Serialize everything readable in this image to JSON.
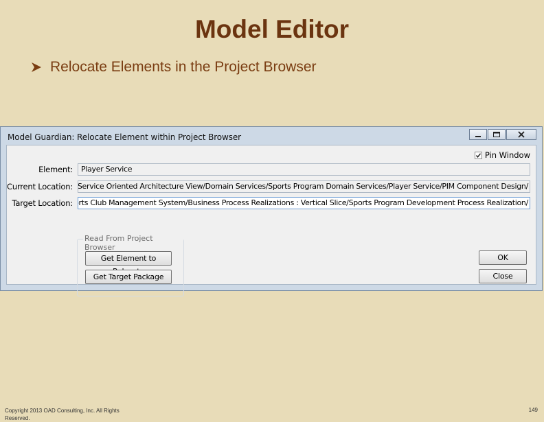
{
  "slide": {
    "title": "Model Editor",
    "bullet": "Relocate Elements in the Project Browser"
  },
  "dialog": {
    "title": "Model Guardian: Relocate Element within Project Browser",
    "pin_window_label": "Pin Window",
    "pin_window_checked": true,
    "fields": {
      "element_label": "Element:",
      "element_value": "Player Service",
      "current_location_label": "Current Location:",
      "current_location_value": "ems Architecture/Service Oriented Architecture View/Domain Services/Sports Program Domain Services/Player Service/PIM Component Design/",
      "target_location_label": "Target Location:",
      "target_location_value": "ample Project/Sports Club Management System/Business Process Realizations : Vertical Slice/Sports Program Development Process Realization/"
    },
    "group": {
      "label": "Read From Project Browser",
      "get_element_button": "Get Element to Relocate",
      "get_target_button": "Get Target Package"
    },
    "ok_button": "OK",
    "close_button": "Close"
  },
  "footer": {
    "copyright": "Copyright 2013 OAD Consulting, Inc. All Rights Reserved.",
    "page_number": "149"
  },
  "colors": {
    "slide_background": "#e8dcb8",
    "title_color": "#6b3410",
    "bullet_color": "#7a3d12",
    "dialog_frame": "#cdd9e6"
  },
  "icons": {
    "bullet": "arrowhead-bullet-icon",
    "minimize": "minimize-icon",
    "maximize": "maximize-icon",
    "close": "close-icon",
    "checkbox": "checkmark-icon"
  }
}
